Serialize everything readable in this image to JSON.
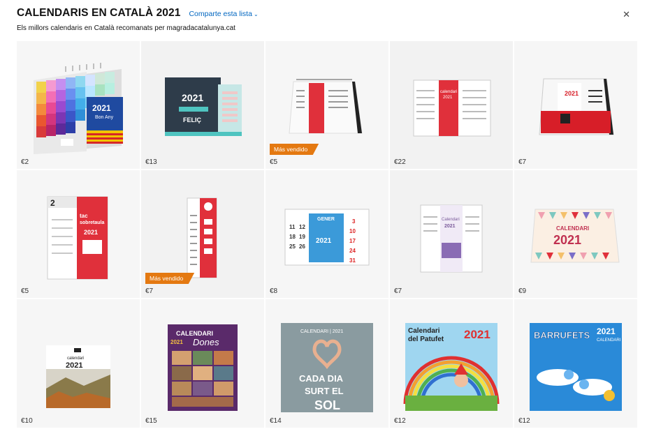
{
  "header": {
    "title": "CALENDARIS EN CATALÀ 2021",
    "share_label": "Comparte esta lista",
    "subtitle": "Els millors calendaris en Català recomanats per magradacatalunya.cat",
    "close_icon": "close-icon"
  },
  "products": [
    {
      "price": "€2",
      "badge": "",
      "cover_lines": [
        "2021",
        "Bon Any"
      ]
    },
    {
      "price": "€13",
      "badge": "",
      "cover_lines": [
        "2021",
        "FELIÇ"
      ]
    },
    {
      "price": "€5",
      "badge": "Más vendido",
      "cover_lines": []
    },
    {
      "price": "€22",
      "badge": "",
      "cover_lines": [
        "calendari",
        "2021"
      ]
    },
    {
      "price": "€7",
      "badge": "",
      "cover_lines": [
        "2021"
      ]
    },
    {
      "price": "€5",
      "badge": "",
      "cover_lines": [
        "2",
        "tac",
        "sobretaula",
        "2021"
      ]
    },
    {
      "price": "€7",
      "badge": "Más vendido",
      "cover_lines": []
    },
    {
      "price": "€8",
      "badge": "",
      "cover_lines": [
        "GENER",
        "2021"
      ]
    },
    {
      "price": "€7",
      "badge": "",
      "cover_lines": [
        "Calendari",
        "2021"
      ]
    },
    {
      "price": "€9",
      "badge": "",
      "cover_lines": [
        "CALENDARI",
        "2021"
      ]
    },
    {
      "price": "€10",
      "badge": "",
      "cover_lines": [
        "calendari",
        "2021"
      ]
    },
    {
      "price": "€15",
      "badge": "",
      "cover_lines": [
        "CALENDARI",
        "2021",
        "Dones"
      ]
    },
    {
      "price": "€14",
      "badge": "",
      "cover_lines": [
        "CALENDARI | 2021",
        "CADA DIA",
        "SURT EL",
        "SOL"
      ]
    },
    {
      "price": "€12",
      "badge": "",
      "cover_lines": [
        "Calendari",
        "del Patufet",
        "2021"
      ]
    },
    {
      "price": "€12",
      "badge": "",
      "cover_lines": [
        "BARRUFETS",
        "2021",
        "CALENDARI"
      ]
    }
  ],
  "colors": {
    "link": "#0066c0",
    "badge": "#e47911",
    "tile_bg": "#f6f6f6"
  }
}
